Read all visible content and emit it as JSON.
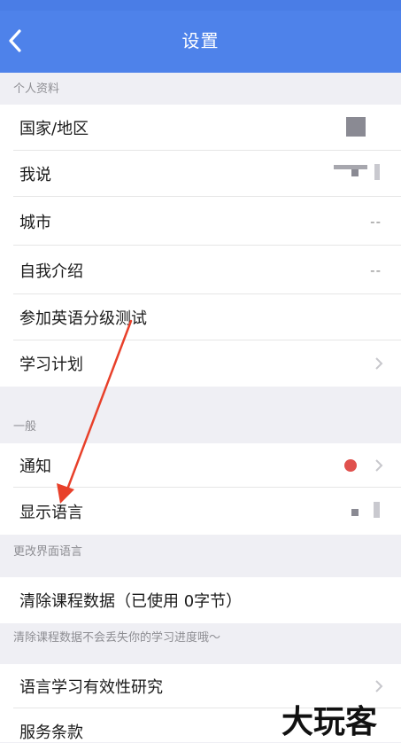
{
  "nav": {
    "title": "设置"
  },
  "profile": {
    "header": "个人资料",
    "country_label": "国家/地区",
    "speak_label": "我说",
    "city_label": "城市",
    "city_value": "--",
    "intro_label": "自我介绍",
    "intro_value": "--",
    "test_label": "参加英语分级测试",
    "plan_label": "学习计划"
  },
  "general": {
    "header": "一般",
    "notify_label": "通知",
    "language_label": "显示语言",
    "language_note": "更改界面语言"
  },
  "data": {
    "clear_label": "清除课程数据（已使用 0字节）",
    "clear_note": "清除课程数据不会丢失你的学习进度哦～"
  },
  "about": {
    "research_label": "语言学习有效性研究",
    "terms_label": "服务条款"
  },
  "colors": {
    "nav_bg": "#4e82ea",
    "badge_red": "#e0504d",
    "annotation_red": "#e8402a"
  },
  "icons": [
    "back-arrow-icon",
    "chevron-right-icon",
    "notification-dot-icon"
  ],
  "watermark_logo": "大玩客"
}
